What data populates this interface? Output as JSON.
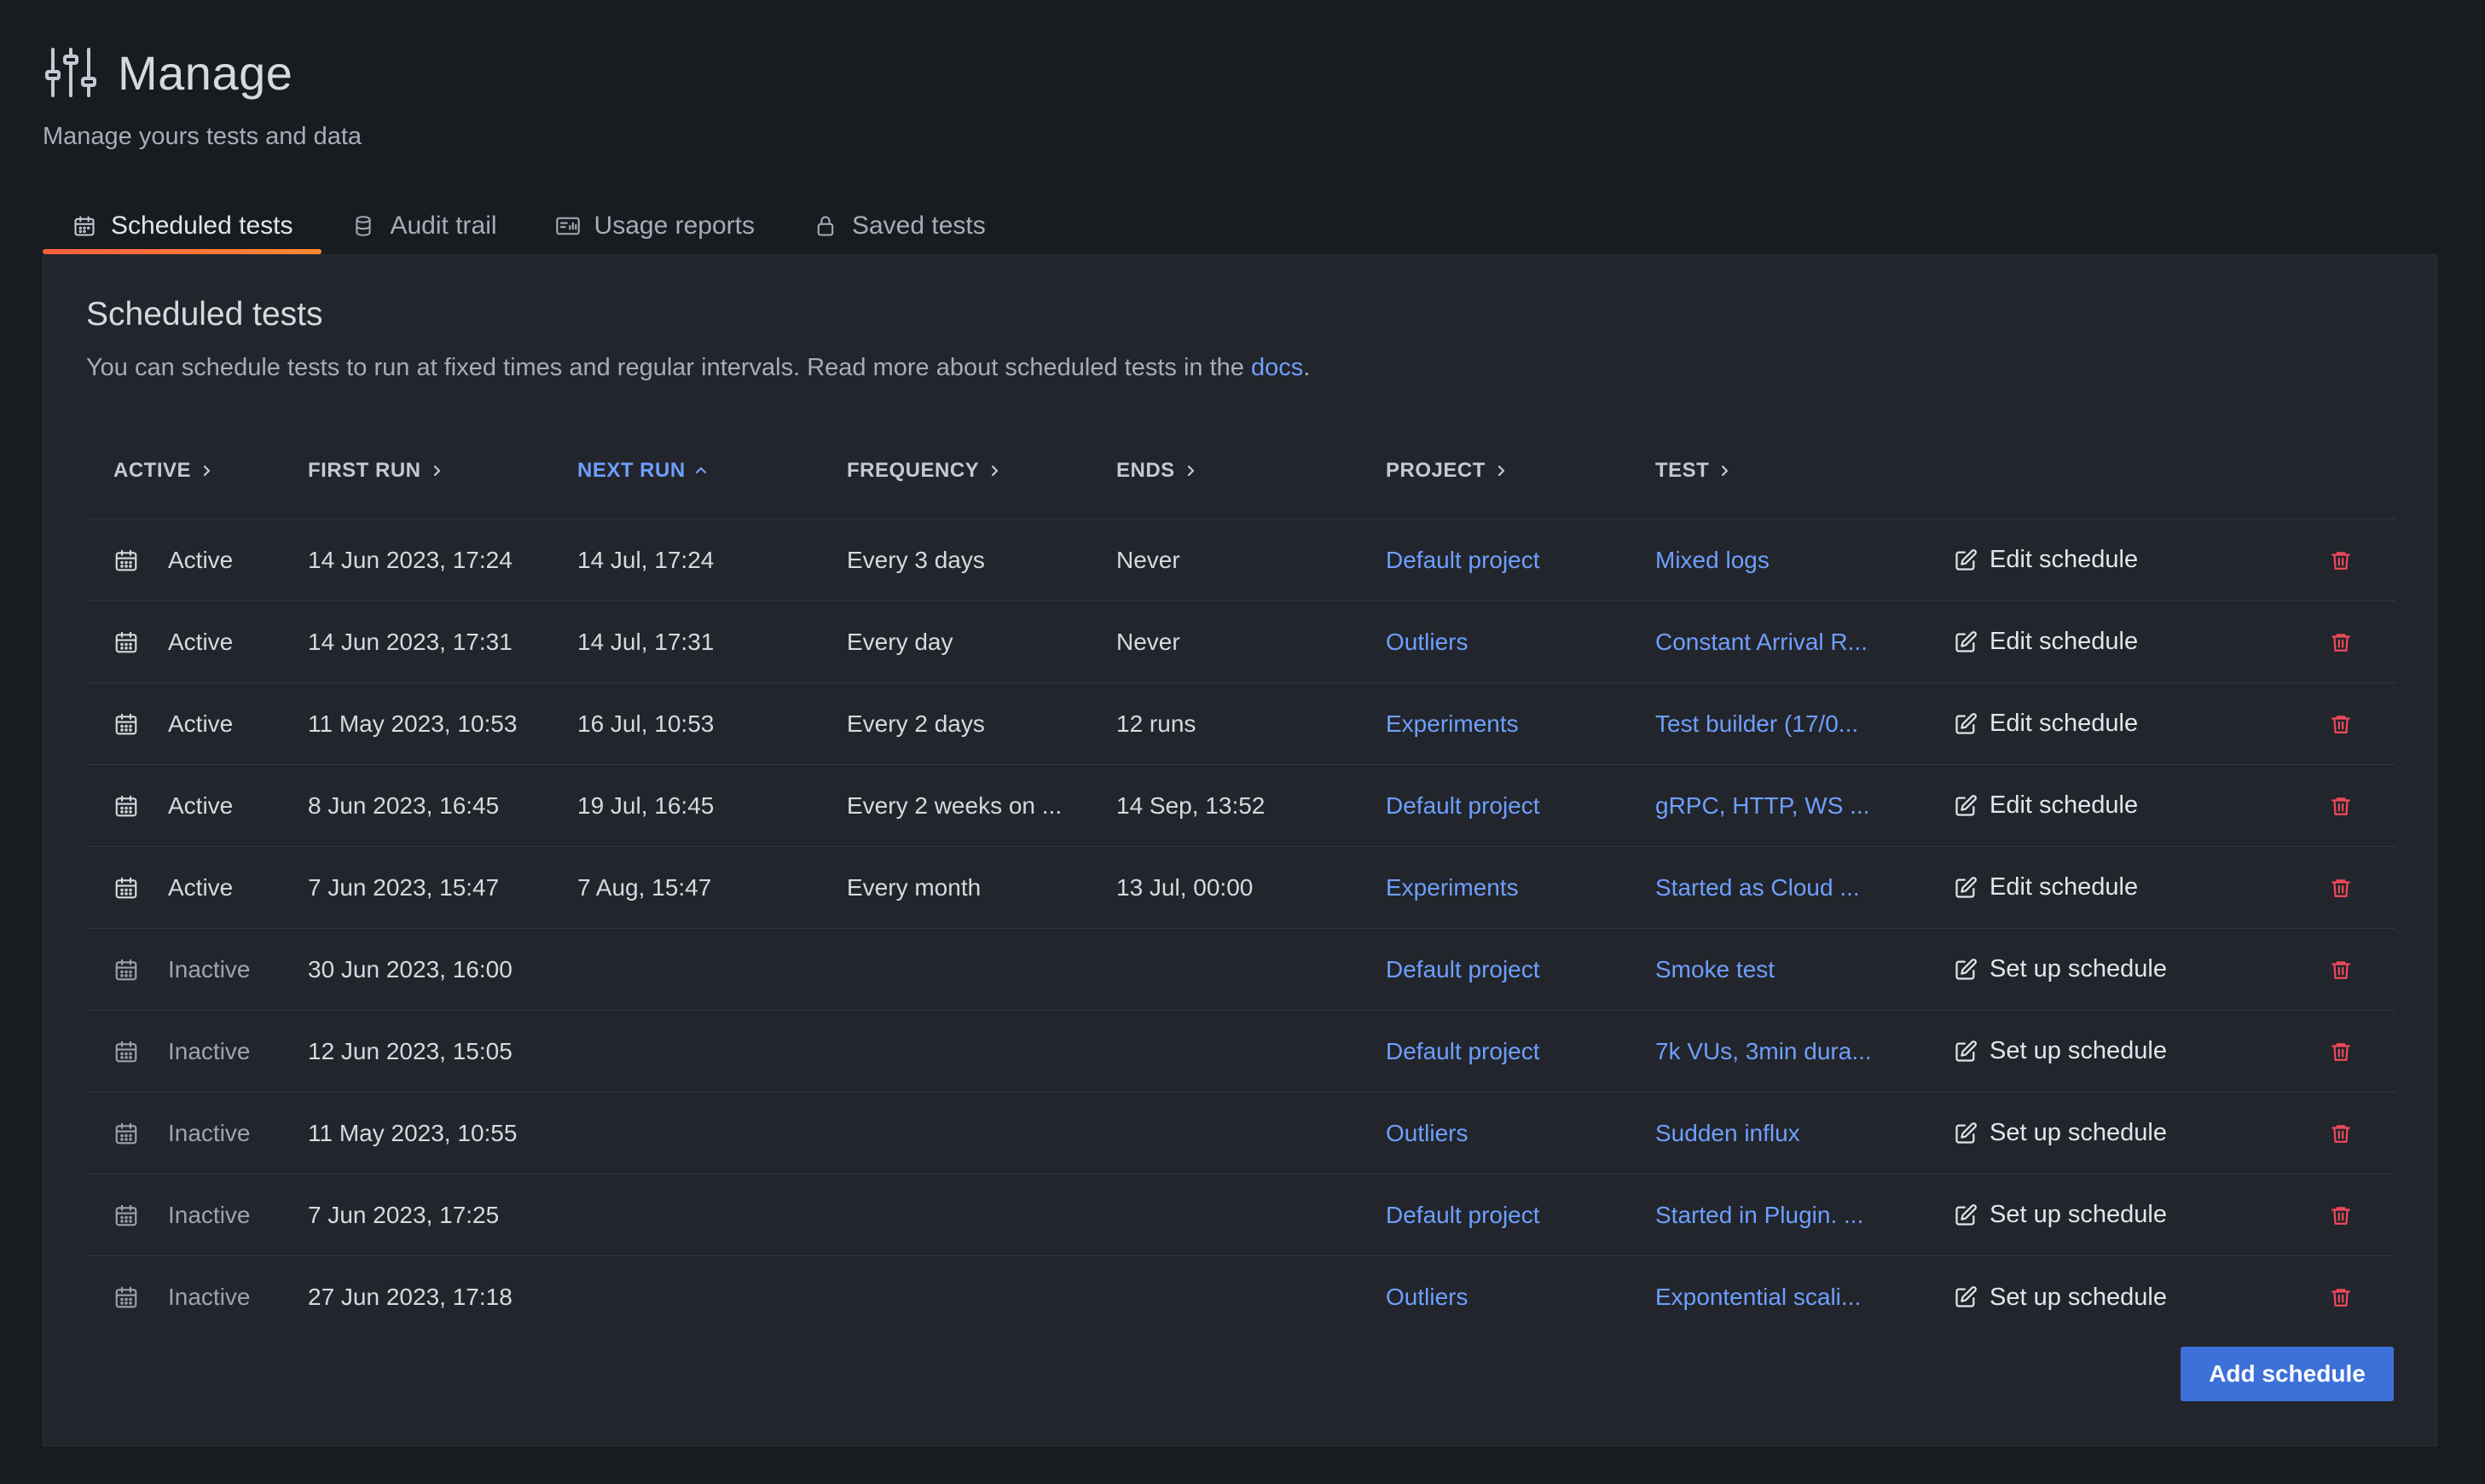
{
  "header": {
    "title": "Manage",
    "subtitle": "Manage yours tests and data",
    "icon": "sliders-icon"
  },
  "tabs": [
    {
      "label": "Scheduled tests",
      "icon": "calendar-icon",
      "active": true
    },
    {
      "label": "Audit trail",
      "icon": "database-icon",
      "active": false
    },
    {
      "label": "Usage reports",
      "icon": "report-icon",
      "active": false
    },
    {
      "label": "Saved tests",
      "icon": "lock-icon",
      "active": false
    }
  ],
  "panel": {
    "title": "Scheduled tests",
    "description": "You can schedule tests to run at fixed times and regular intervals. Read more about scheduled tests in the ",
    "docs_link": "docs",
    "description_end": "."
  },
  "table": {
    "columns": {
      "active": "ACTIVE",
      "first_run": "FIRST RUN",
      "next_run": "NEXT RUN",
      "frequency": "FREQUENCY",
      "ends": "ENDS",
      "project": "PROJECT",
      "test": "TEST"
    },
    "sorted_column": "next_run",
    "rows": [
      {
        "status": "Active",
        "first_run": "14 Jun 2023, 17:24",
        "next_run": "14 Jul, 17:24",
        "frequency": "Every 3 days",
        "ends": "Never",
        "project": "Default project",
        "test": "Mixed logs",
        "action": "Edit schedule"
      },
      {
        "status": "Active",
        "first_run": "14 Jun 2023, 17:31",
        "next_run": "14 Jul, 17:31",
        "frequency": "Every day",
        "ends": "Never",
        "project": "Outliers",
        "test": "Constant Arrival R...",
        "action": "Edit schedule"
      },
      {
        "status": "Active",
        "first_run": "11 May 2023, 10:53",
        "next_run": "16 Jul, 10:53",
        "frequency": "Every 2 days",
        "ends": "12 runs",
        "project": "Experiments",
        "test": "Test builder (17/0...",
        "action": "Edit schedule"
      },
      {
        "status": "Active",
        "first_run": "8 Jun 2023, 16:45",
        "next_run": "19 Jul, 16:45",
        "frequency": "Every 2 weeks on ...",
        "ends": "14 Sep, 13:52",
        "project": "Default project",
        "test": "gRPC, HTTP, WS ...",
        "action": "Edit schedule"
      },
      {
        "status": "Active",
        "first_run": "7 Jun 2023, 15:47",
        "next_run": "7 Aug, 15:47",
        "frequency": "Every month",
        "ends": "13 Jul, 00:00",
        "project": "Experiments",
        "test": "Started as Cloud ...",
        "action": "Edit schedule"
      },
      {
        "status": "Inactive",
        "first_run": "30 Jun 2023, 16:00",
        "next_run": "",
        "frequency": "",
        "ends": "",
        "project": "Default project",
        "test": "Smoke test",
        "action": "Set up schedule"
      },
      {
        "status": "Inactive",
        "first_run": "12 Jun 2023, 15:05",
        "next_run": "",
        "frequency": "",
        "ends": "",
        "project": "Default project",
        "test": "7k VUs, 3min dura...",
        "action": "Set up schedule"
      },
      {
        "status": "Inactive",
        "first_run": "11 May 2023, 10:55",
        "next_run": "",
        "frequency": "",
        "ends": "",
        "project": "Outliers",
        "test": "Sudden influx",
        "action": "Set up schedule"
      },
      {
        "status": "Inactive",
        "first_run": "7 Jun 2023, 17:25",
        "next_run": "",
        "frequency": "",
        "ends": "",
        "project": "Default project",
        "test": "Started in Plugin. ...",
        "action": "Set up schedule"
      },
      {
        "status": "Inactive",
        "first_run": "27 Jun 2023, 17:18",
        "next_run": "",
        "frequency": "",
        "ends": "",
        "project": "Outliers",
        "test": "Expontential scali...",
        "action": "Set up schedule"
      }
    ]
  },
  "add_button": "Add schedule",
  "colors": {
    "background": "#181b1f",
    "panel": "#22252b",
    "link": "#6e9fff",
    "primary": "#3d71d9",
    "danger": "#f2495c",
    "tab_underline": "#f55f3e"
  }
}
